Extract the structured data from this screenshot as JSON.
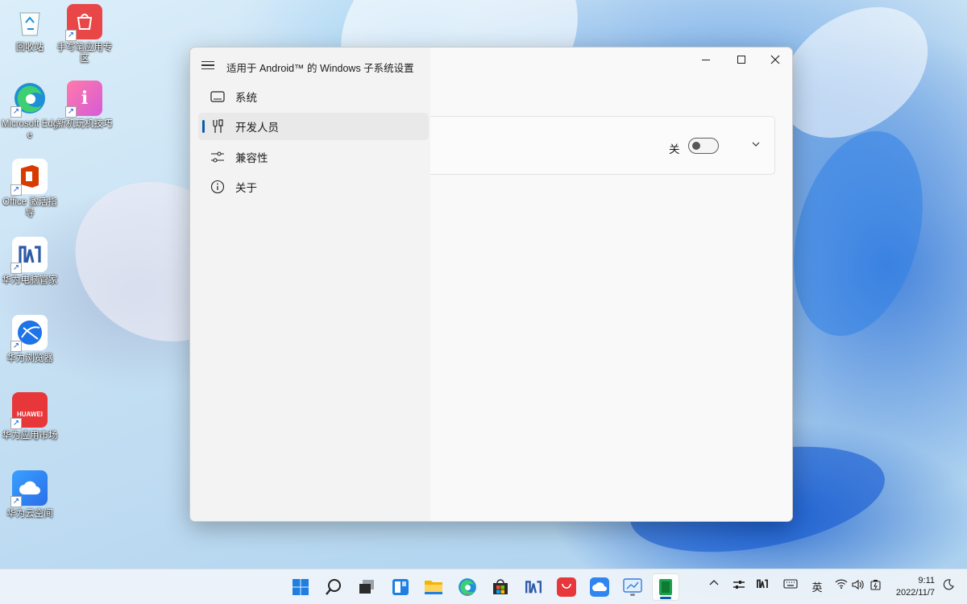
{
  "desktop": {
    "icons": [
      {
        "label": "回收站"
      },
      {
        "label": "手写笔应用专区"
      },
      {
        "label": "Microsoft Edge"
      },
      {
        "label": "新机玩机技巧"
      },
      {
        "label": "Office 激活指导"
      },
      {
        "label": "华为电脑管家"
      },
      {
        "label": "华为浏览器"
      },
      {
        "label": "华为应用市场"
      },
      {
        "label": "华为云空间"
      }
    ]
  },
  "window": {
    "title": "适用于 Android™ 的 Windows 子系统设置",
    "nav": [
      {
        "label": "系统",
        "icon": "display-icon"
      },
      {
        "label": "开发人员",
        "icon": "tools-icon",
        "selected": true
      },
      {
        "label": "兼容性",
        "icon": "sliders-icon"
      },
      {
        "label": "关于",
        "icon": "info-icon"
      }
    ],
    "developer_card": {
      "toggle_state_label": "关",
      "toggle_on": false
    }
  },
  "taskbar": {
    "icons": [
      "windows-start-icon",
      "search-icon",
      "task-view-icon",
      "widgets-icon",
      "file-explorer-icon",
      "edge-icon",
      "store-icon",
      "pc-manager-icon",
      "huawei-appgallery-icon",
      "cloud-space-icon",
      "settings-preview-icon",
      "android-subsystem-icon"
    ],
    "ime_label": "英",
    "time": "9:11",
    "date": "2022/11/7"
  },
  "colors": {
    "accent": "#0b5cad",
    "window_bg": "#f3f3f3",
    "content_bg": "#f9f9f9"
  }
}
